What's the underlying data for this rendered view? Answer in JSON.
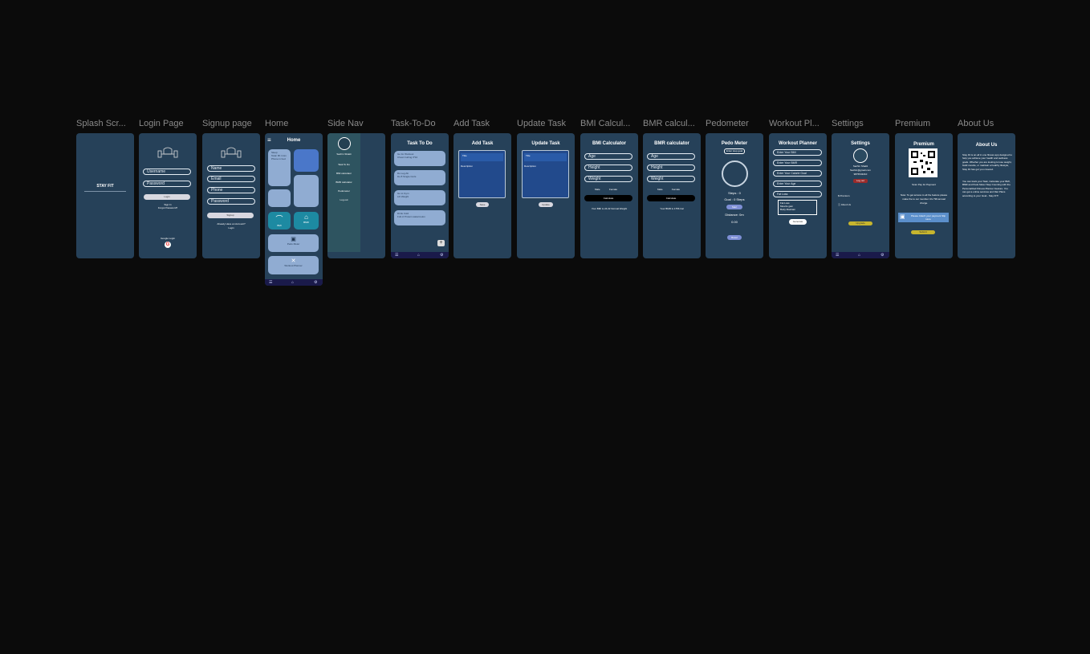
{
  "labels": [
    "Splash Scr...",
    "Login Page",
    "Signup page",
    "Home",
    "Side Nav",
    "Task-To-Do",
    "Add Task",
    "Update Task",
    "BMI Calcul...",
    "BMR calcul...",
    "Pedometer",
    "Workout Pl...",
    "Settings",
    "Premium",
    "About Us"
  ],
  "splash": {
    "title": "STAY FIT"
  },
  "login": {
    "username": "Username",
    "password": "Password",
    "login_btn": "Login",
    "signup_link": "Sign In",
    "forgot": "Forgot Password?",
    "google": "Google Login",
    "google_icon": "G"
  },
  "signup": {
    "name": "Name",
    "email": "Email",
    "phone": "Phone",
    "password": "Password",
    "signup_btn": "Signup",
    "have_account": "Already Have an Account?",
    "login_link": "Login"
  },
  "home": {
    "title": "Home",
    "menu_icon": "≡",
    "card_sleep": "Sleep",
    "card_sleep2": "Total: 8h 1min",
    "card_sleep3": "Phone in bed",
    "bmi": "BMI",
    "bmr": "BMR",
    "pedometer": "Pedo Meter",
    "workout": "Workout Planner",
    "nav_home": "⌂",
    "nav_task": "☰",
    "nav_settings": "⚙"
  },
  "sidenav": {
    "user": "Sachin Shakti",
    "items": [
      "Task To Do",
      "BMI calculator",
      "BMR calculator",
      "Pedometer",
      "Log out"
    ]
  },
  "tasks": {
    "title": "Task To Do",
    "items": [
      {
        "t": "Go for Workout",
        "d": "Chest Curling 3*10"
      },
      {
        "t": "Do Leg Ab",
        "d": "Do 8 Single Curls"
      },
      {
        "t": "Go to Gym",
        "d": "Lift Weight"
      },
      {
        "t": "Drink Cold",
        "d": "Full of Protein watermelon"
      }
    ],
    "add": "+"
  },
  "addtask": {
    "title": "Add Task",
    "field_title": "Title",
    "field_desc": "Description",
    "btn": "Save"
  },
  "updatetask": {
    "title": "Update Task",
    "field_title": "Title",
    "field_desc": "Description",
    "btn": "Update"
  },
  "bmi": {
    "title": "BMI Calculator",
    "age": "Age",
    "height": "Height",
    "weight": "Weight",
    "male": "Male",
    "female": "Female",
    "btn": "Calculate",
    "result": "Your BMI is 24.22 Normal Weight"
  },
  "bmr": {
    "title": "BMR calculator",
    "age": "Age",
    "height": "Height",
    "weight": "Weight",
    "male": "Male",
    "female": "Female",
    "btn": "Calculate",
    "result": "Your BMR is 1756 Cal"
  },
  "pedo": {
    "title": "Pedo Meter",
    "enter_goal": "Enter step goal",
    "steps": "Steps : 0",
    "goal": "Goal : 0 Steps",
    "start": "Start",
    "distance": "Distance: 0m",
    "dist_val": "0.00",
    "reset": "Reset"
  },
  "workout": {
    "title": "Workout Planner",
    "fields": [
      "Enter Your BMI",
      "Enter Your BMR",
      "Enter Your Calorie Goal",
      "Enter Your Age",
      "Fat Loss"
    ],
    "options": [
      "Fat Loss",
      "Muscle gain",
      "Body Maintain"
    ],
    "btn": "Generate"
  },
  "settings": {
    "title": "Settings",
    "name": "Sachin Shakti",
    "email": "Sachin@gmail.com",
    "phone": "9876543210",
    "logout": "Log out",
    "premium": "Premium",
    "about": "About Us",
    "upgrade": "Upgrade"
  },
  "premium": {
    "title": "Premium",
    "scan": "Scan Pay for Payment",
    "note": "Note: To get access to all the feature please make the to our member. Rs 799 annual charge.",
    "upload": "Please Attach your payment Slip Here",
    "btn": "Submit"
  },
  "about": {
    "title": "About Us",
    "p1": "Stay Fit is an all in one fitness app designed to help you achieve your health and wellness goals. Whether you are looking to lose weight, build muscle, or maintain a healthy lifestyle, Stay Fit has got you covered.",
    "p2": "You can track your Task, Calculate your BMI, BMR and Pedo Meter Step Counting with the Personalized Fitness Planner Feature. You can get a online services and Diet Plans according to your Goal - Stay FIT!"
  }
}
